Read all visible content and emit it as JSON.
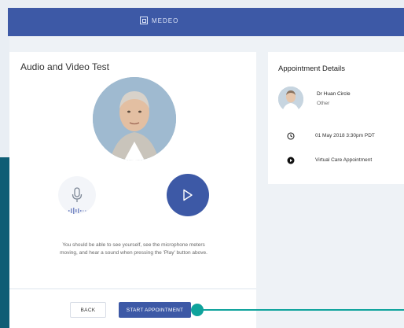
{
  "app": {
    "brand": "MEDEO"
  },
  "test_card": {
    "title": "Audio and Video Test",
    "help_text": "You should be able to see yourself, see the microphone meters moving, and hear a sound when pressing the 'Play' button above."
  },
  "actions": {
    "back_label": "BACK",
    "start_label": "START APPOINTMENT"
  },
  "appointment": {
    "title": "Appointment Details",
    "doctor_name": "Dr Huan Circle",
    "doctor_type": "Other",
    "datetime": "01 May 2018 3:30pm PDT",
    "type": "Virtual Care Appointment",
    "icons": {
      "time": "clock-icon",
      "type": "video-icon"
    }
  },
  "colors": {
    "brand": "#3d59a6",
    "accent": "#0fa39c",
    "dark_accent": "#0f5d75"
  }
}
